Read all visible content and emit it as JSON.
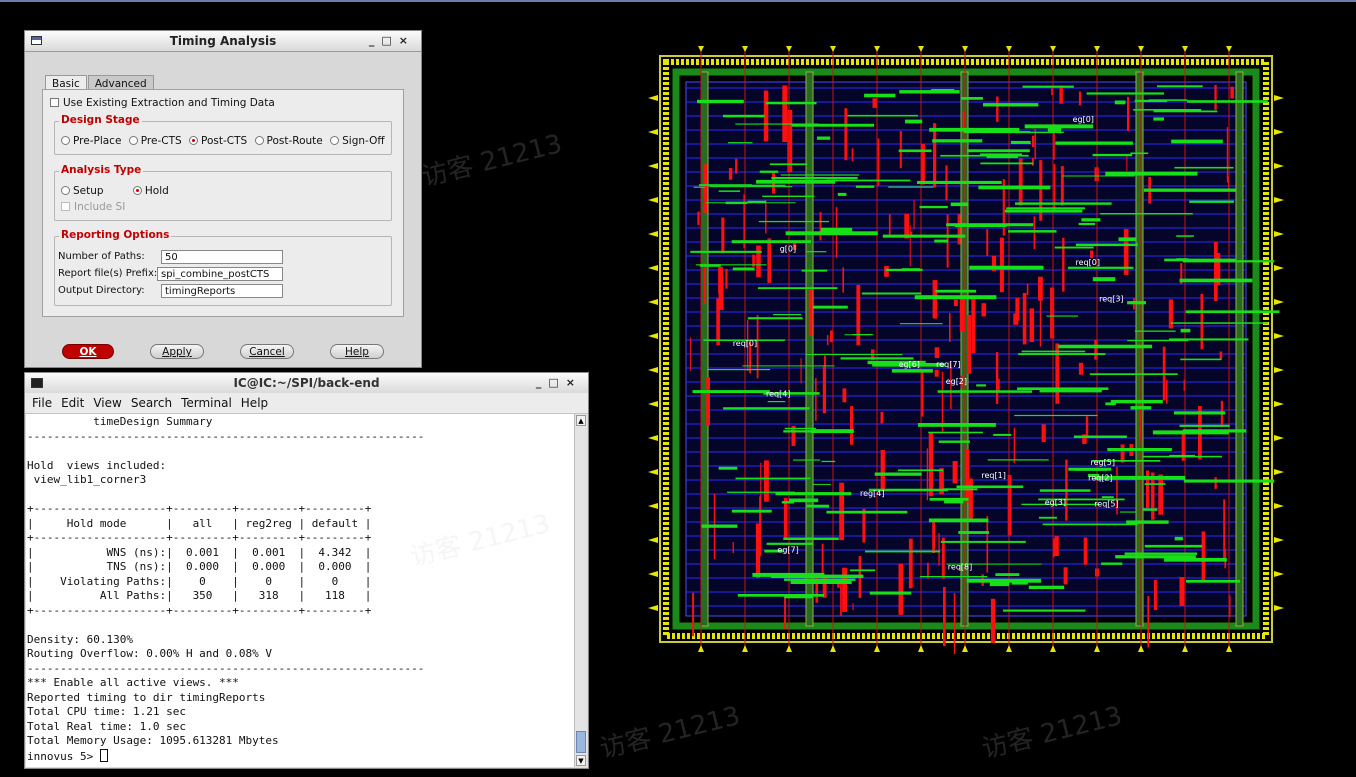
{
  "watermark": "访客 21213",
  "dialog": {
    "title": "Timing Analysis",
    "window_buttons": [
      "_",
      "□",
      "×"
    ],
    "tabs": [
      {
        "label": "Basic",
        "active": true
      },
      {
        "label": "Advanced",
        "active": false
      }
    ],
    "use_existing_label": "Use Existing Extraction and Timing Data",
    "design_stage": {
      "title": "Design Stage",
      "options": [
        {
          "label": "Pre-Place",
          "selected": false
        },
        {
          "label": "Pre-CTS",
          "selected": false
        },
        {
          "label": "Post-CTS",
          "selected": true
        },
        {
          "label": "Post-Route",
          "selected": false
        },
        {
          "label": "Sign-Off",
          "selected": false
        }
      ]
    },
    "analysis_type": {
      "title": "Analysis Type",
      "options": [
        {
          "label": "Setup",
          "selected": false
        },
        {
          "label": "Hold",
          "selected": true
        }
      ],
      "include_si_label": "Include SI"
    },
    "reporting": {
      "title": "Reporting Options",
      "num_paths_label": "Number of Paths:",
      "num_paths_value": "50",
      "prefix_label": "Report file(s) Prefix:",
      "prefix_value": "spi_combine_postCTS",
      "outdir_label": "Output Directory:",
      "outdir_value": "timingReports"
    },
    "buttons": {
      "ok": "OK",
      "apply": "Apply",
      "cancel": "Cancel",
      "help": "Help"
    }
  },
  "terminal": {
    "title": "IC@IC:~/SPI/back-end",
    "window_buttons": [
      "_",
      "□",
      "×"
    ],
    "menu": [
      "File",
      "Edit",
      "View",
      "Search",
      "Terminal",
      "Help"
    ],
    "text": "          timeDesign Summary\n------------------------------------------------------------\n\nHold  views included:\n view_lib1_corner3\n\n+--------------------+---------+---------+---------+\n|     Hold mode      |   all   | reg2reg | default |\n+--------------------+---------+---------+---------+\n|           WNS (ns):|  0.001  |  0.001  |  4.342  |\n|           TNS (ns):|  0.000  |  0.000  |  0.000  |\n|    Violating Paths:|    0    |    0    |    0    |\n|          All Paths:|   350   |   318   |   118   |\n+--------------------+---------+---------+---------+\n\nDensity: 60.130%\nRouting Overflow: 0.00% H and 0.08% V\n------------------------------------------------------------\n*** Enable all active views. ***\nReported timing to dir timingReports\nTotal CPU time: 1.21 sec\nTotal Real time: 1.0 sec\nTotal Memory Usage: 1095.613281 Mbytes",
    "prompt": "innovus 5> "
  },
  "layout_view": {
    "instance_labels": [
      "req[8]",
      "g[0]",
      "reg[4]",
      "eg[2]",
      "req[7]",
      "req[4]",
      "req[3]",
      "req[1]",
      "req[5]",
      "req[2]",
      "req[0]",
      "eg[3]",
      "eg[0]",
      "eg[6]",
      "eg[7]",
      "req[0]",
      "reg[5]"
    ]
  }
}
